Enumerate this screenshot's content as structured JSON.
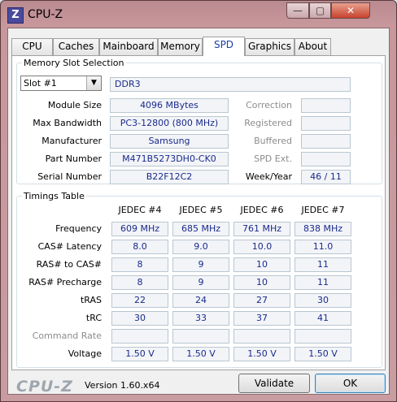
{
  "window": {
    "title": "CPU-Z",
    "icon_letter": "Z",
    "minimize": "—",
    "maximize": "▢",
    "close": "✕"
  },
  "tabs": [
    {
      "label": "CPU"
    },
    {
      "label": "Caches"
    },
    {
      "label": "Mainboard"
    },
    {
      "label": "Memory"
    },
    {
      "label": "SPD"
    },
    {
      "label": "Graphics"
    },
    {
      "label": "About"
    }
  ],
  "slot_section": {
    "title": "Memory Slot Selection",
    "slot_value": "Slot #1",
    "type": "DDR3",
    "module_size_label": "Module Size",
    "module_size": "4096 MBytes",
    "bandwidth_label": "Max Bandwidth",
    "bandwidth": "PC3-12800 (800 MHz)",
    "manufacturer_label": "Manufacturer",
    "manufacturer": "Samsung",
    "part_label": "Part Number",
    "part": "M471B5273DH0-CK0",
    "serial_label": "Serial Number",
    "serial": "B22F12C2",
    "correction_label": "Correction",
    "correction": "",
    "registered_label": "Registered",
    "registered": "",
    "buffered_label": "Buffered",
    "buffered": "",
    "spdext_label": "SPD Ext.",
    "spdext": "",
    "weekyear_label": "Week/Year",
    "weekyear": "46 / 11"
  },
  "timings": {
    "title": "Timings Table",
    "columns": [
      "JEDEC #4",
      "JEDEC #5",
      "JEDEC #6",
      "JEDEC #7"
    ],
    "rows": [
      {
        "label": "Frequency",
        "values": [
          "609 MHz",
          "685 MHz",
          "761 MHz",
          "838 MHz"
        ]
      },
      {
        "label": "CAS# Latency",
        "values": [
          "8.0",
          "9.0",
          "10.0",
          "11.0"
        ]
      },
      {
        "label": "RAS# to CAS#",
        "values": [
          "8",
          "9",
          "10",
          "11"
        ]
      },
      {
        "label": "RAS# Precharge",
        "values": [
          "8",
          "9",
          "10",
          "11"
        ]
      },
      {
        "label": "tRAS",
        "values": [
          "22",
          "24",
          "27",
          "30"
        ]
      },
      {
        "label": "tRC",
        "values": [
          "30",
          "33",
          "37",
          "41"
        ]
      },
      {
        "label": "Command Rate",
        "values": [
          "",
          "",
          "",
          ""
        ]
      },
      {
        "label": "Voltage",
        "values": [
          "1.50 V",
          "1.50 V",
          "1.50 V",
          "1.50 V"
        ]
      }
    ]
  },
  "footer": {
    "logo": "CPU-Z",
    "version": "Version 1.60.x64",
    "validate": "Validate",
    "ok": "OK"
  }
}
